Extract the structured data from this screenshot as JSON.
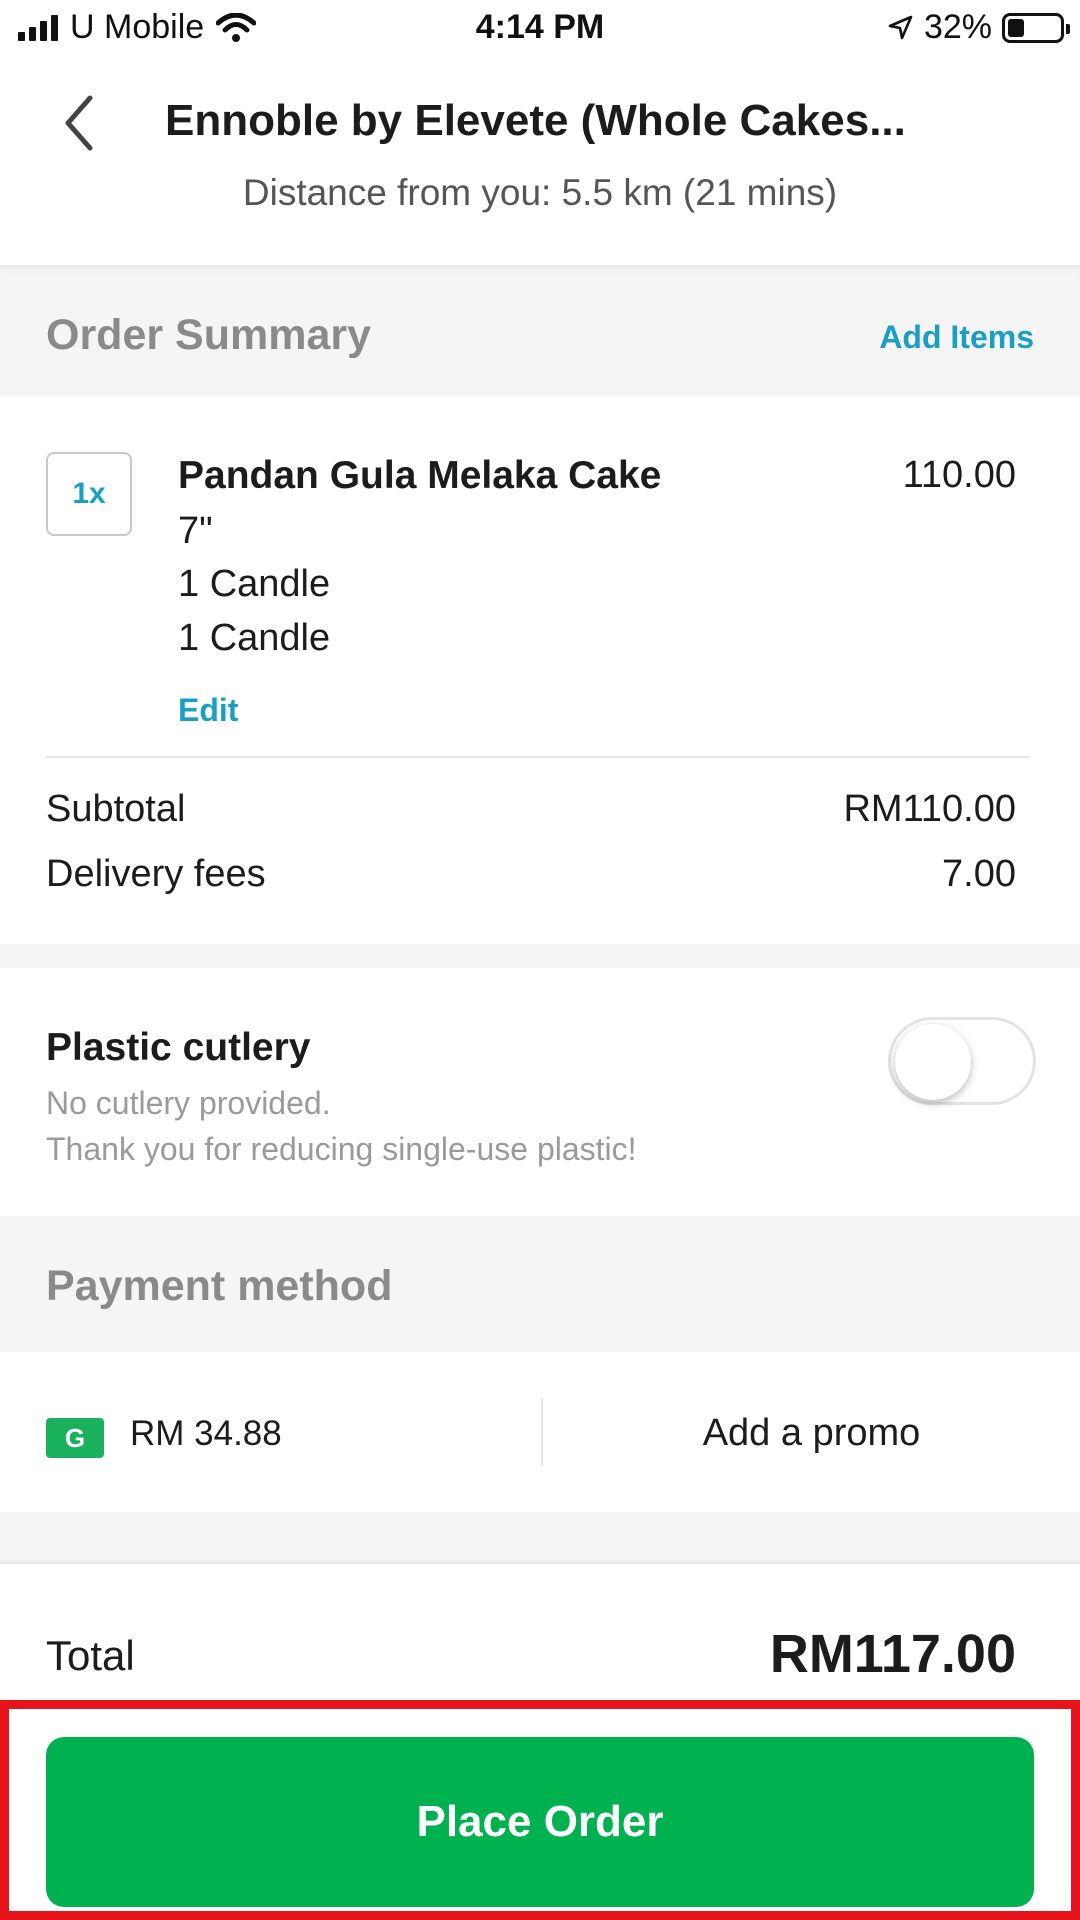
{
  "status_bar": {
    "carrier": "U Mobile",
    "time": "4:14 PM",
    "battery": "32%",
    "icons": [
      "signal-icon",
      "wifi-icon",
      "location-arrow-icon",
      "battery-icon"
    ]
  },
  "header": {
    "title": "Ennoble by Elevete (Whole Cakes...",
    "subtitle": "Distance from you: 5.5 km (21 mins)"
  },
  "order_summary": {
    "title": "Order Summary",
    "add_items_label": "Add Items",
    "items": [
      {
        "quantity": "1x",
        "name": "Pandan Gula Melaka Cake",
        "price": "110.00",
        "modifiers": [
          "7\"",
          "1 Candle",
          "1 Candle"
        ],
        "edit_label": "Edit"
      }
    ],
    "subtotal_label": "Subtotal",
    "subtotal_value": "RM110.00",
    "delivery_label": "Delivery fees",
    "delivery_value": "7.00"
  },
  "cutlery": {
    "title": "Plastic cutlery",
    "line1": "No cutlery provided.",
    "line2": "Thank you for reducing single-use plastic!",
    "enabled": false
  },
  "payment": {
    "title": "Payment method",
    "wallet_badge": "G",
    "wallet_amount": "RM 34.88",
    "promo_label": "Add a promo"
  },
  "total": {
    "label": "Total",
    "value": "RM117.00"
  },
  "cta": {
    "label": "Place Order"
  },
  "colors": {
    "accent_link": "#1a9ec4",
    "primary_green": "#00b14f",
    "highlight_red": "#e8141c"
  }
}
